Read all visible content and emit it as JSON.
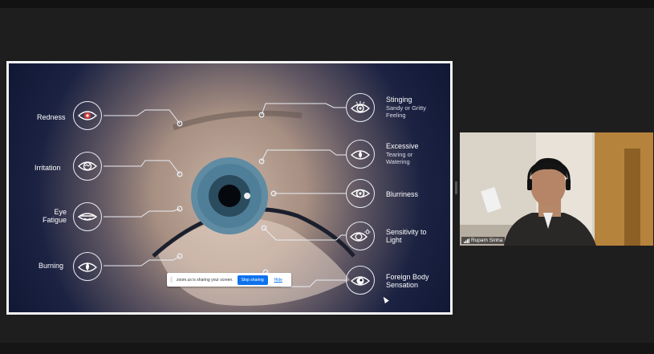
{
  "slide": {
    "left_symptoms": [
      {
        "lines": [
          "Redness"
        ]
      },
      {
        "lines": [
          "Irritation"
        ]
      },
      {
        "lines": [
          "Eye",
          "Fatigue"
        ]
      },
      {
        "lines": [
          "Burning"
        ]
      }
    ],
    "right_symptoms": [
      {
        "title": "Stinging",
        "sub": [
          "Sandy or Gritty",
          "Feeling"
        ]
      },
      {
        "title": "Excessive",
        "sub": [
          "Tearing or",
          "Watering"
        ]
      },
      {
        "title": "Blurriness",
        "sub": []
      },
      {
        "title": "Sensitivity to",
        "sub": [
          "Light"
        ]
      },
      {
        "title": "Foreign Body",
        "sub": [
          "Sensation"
        ]
      }
    ],
    "colors": {
      "accent_red": "#d83a3a",
      "line": "#e9edf4"
    }
  },
  "share_bar": {
    "message": "zoom.us is sharing your screen.",
    "stop_label": "Stop sharing",
    "hide_label": "Hide"
  },
  "participant": {
    "name": "Rupam Sinha"
  }
}
